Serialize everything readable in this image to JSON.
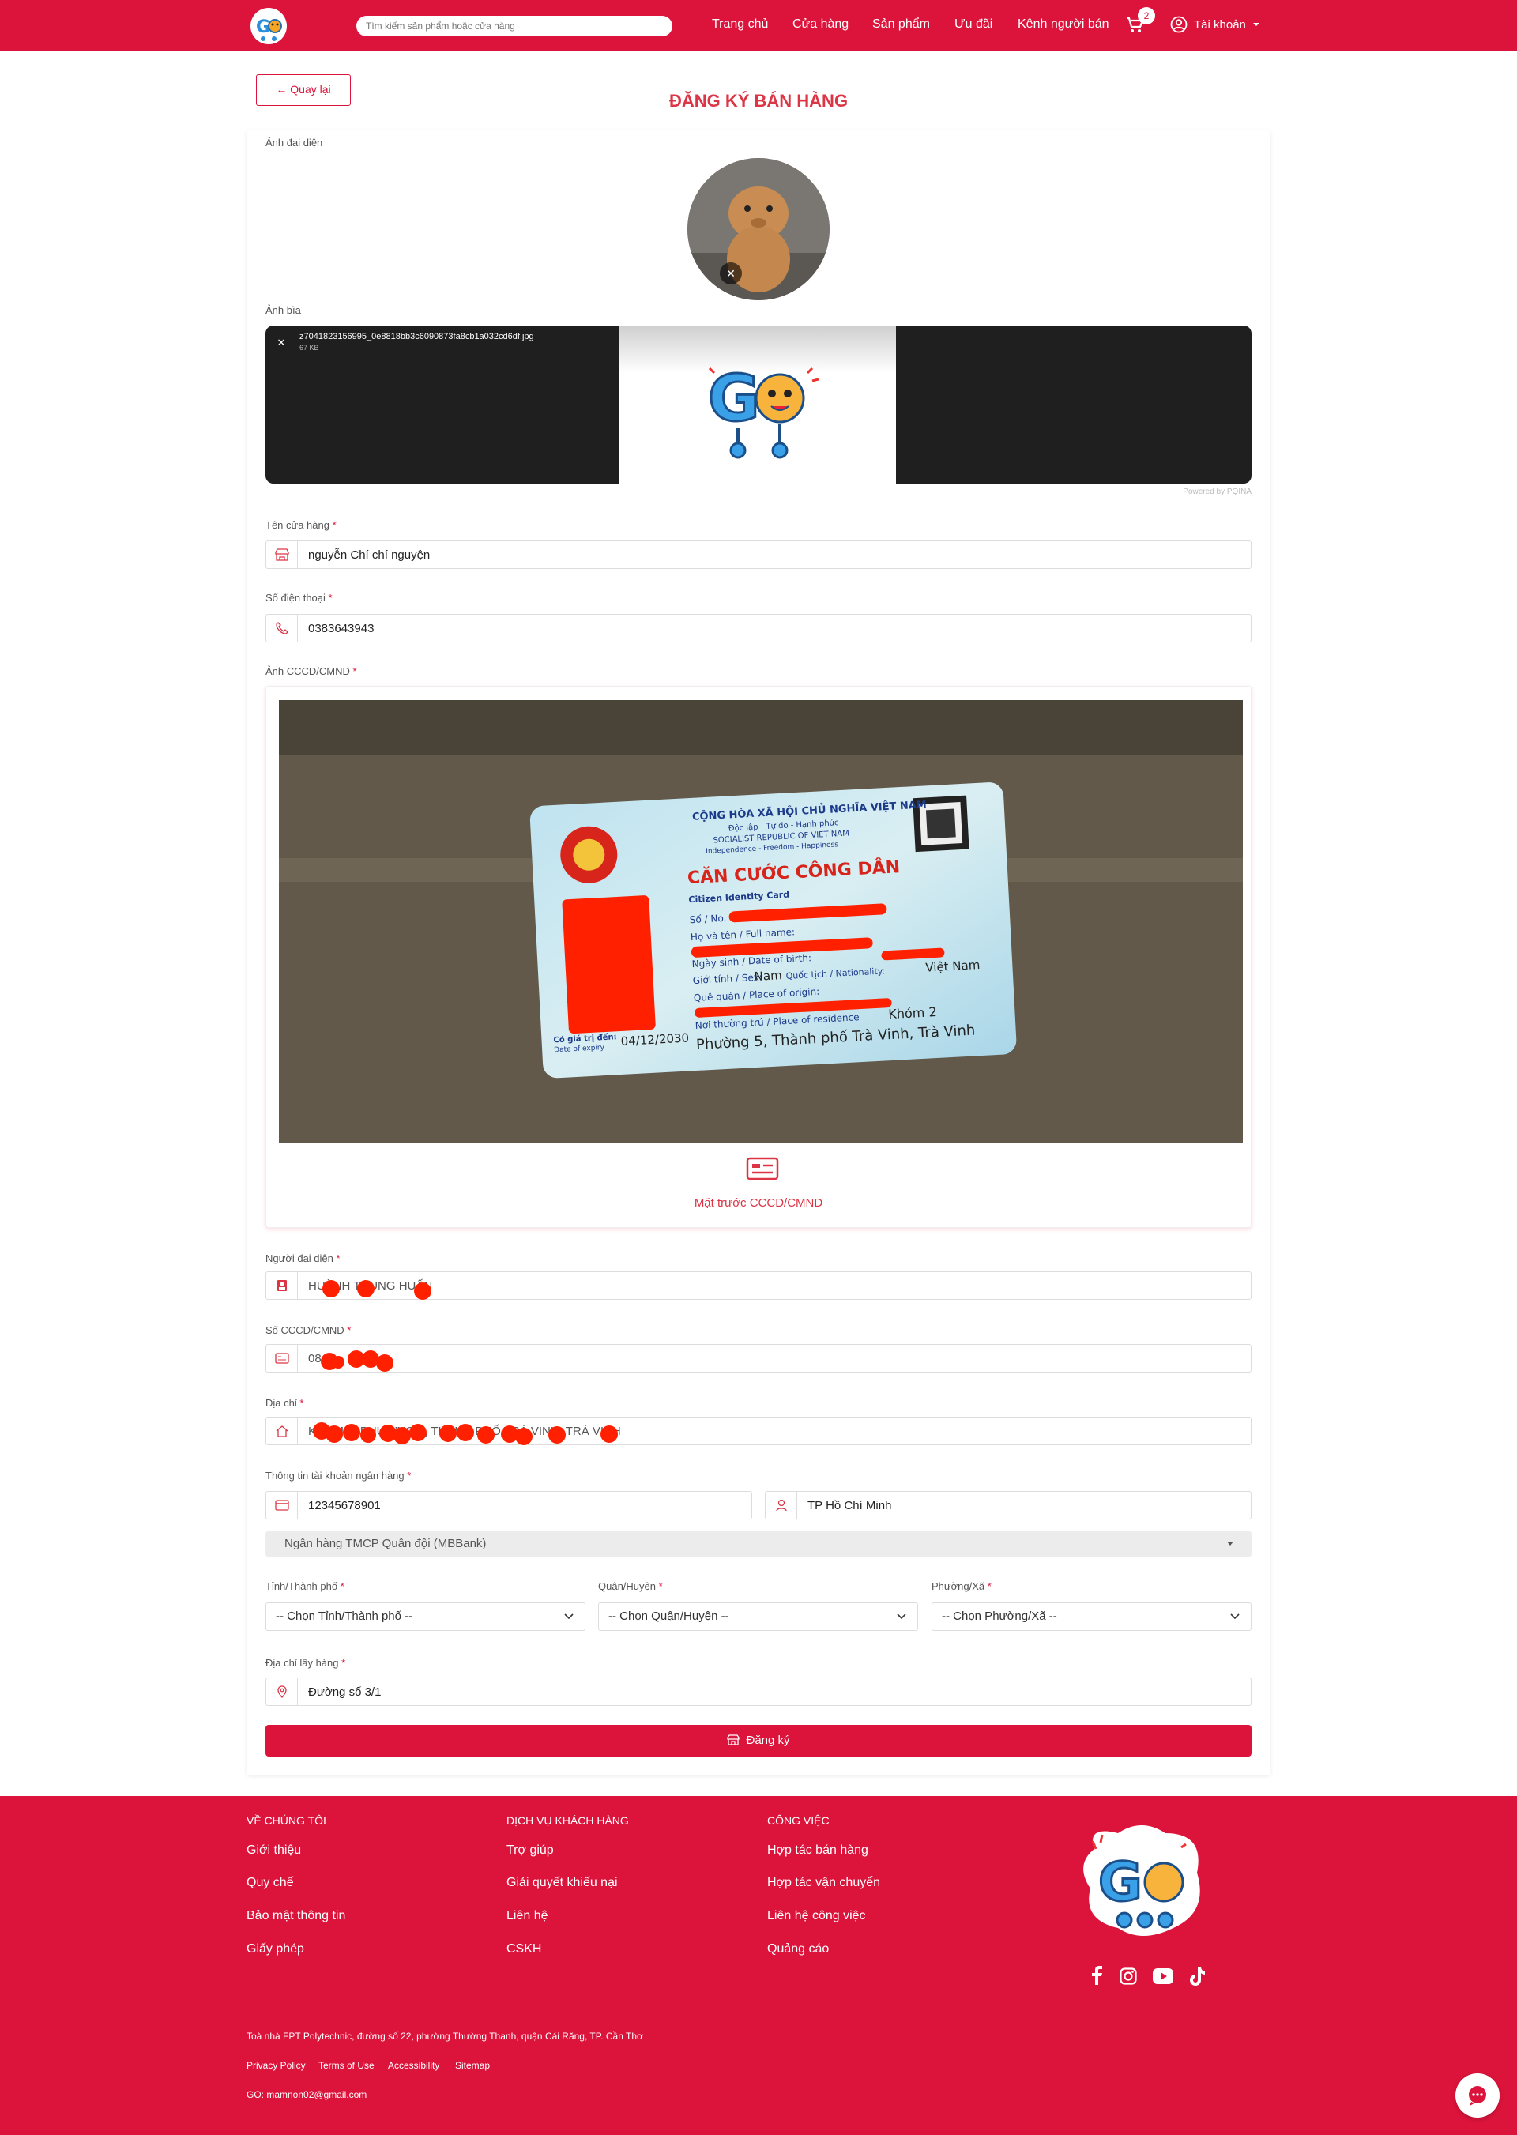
{
  "header": {
    "search_placeholder": "Tìm kiếm sản phẩm hoặc cửa hàng",
    "nav": [
      "Trang chủ",
      "Cửa hàng",
      "Sản phẩm",
      "Ưu đãi",
      "Kênh người bán"
    ],
    "cart_count": "2",
    "account_label": "Tài khoản"
  },
  "page": {
    "back_label": "← Quay lại",
    "title": "ĐĂNG KÝ BÁN HÀNG"
  },
  "form": {
    "avatar_label": "Ảnh đại diện",
    "cover_label": "Ảnh bìa",
    "cover_file_name": "z7041823156995_0e8818bb3c6090873fa8cb1a032cd6df.jpg",
    "cover_file_size": "67 KB",
    "powered_by": "Powered by PQINA",
    "store_name_label": "Tên cửa hàng",
    "store_name_value": "nguyễn Chí chí nguyện",
    "phone_label": "Số điện thoại",
    "phone_value": "0383643943",
    "id_image_label": "Ảnh CCCD/CMND",
    "id_image_caption": "Mặt trước CCCD/CMND",
    "representative_label": "Người đại diện",
    "representative_value": "HUỲNH TRUNG HUẤN",
    "id_number_label": "Số CCCD/CMND",
    "id_number_value": "084...",
    "address_label": "Địa chỉ",
    "address_value": "KHÓM 2, PHƯỜNG 5, THÀNH PHỐ TRÀ VINH, TRÀ VINH",
    "bank_info_label": "Thông tin tài khoản ngân hàng",
    "bank_account_value": "12345678901",
    "bank_holder_value": "TP Hồ Chí Minh",
    "bank_name_value": "Ngân hàng TMCP Quân đội (MBBank)",
    "province_label": "Tỉnh/Thành phố",
    "province_value": "-- Chọn Tỉnh/Thành phố --",
    "district_label": "Quận/Huyện",
    "district_value": "-- Chọn Quận/Huyện --",
    "ward_label": "Phường/Xã",
    "ward_value": "-- Chọn Phường/Xã --",
    "pickup_label": "Địa chỉ lấy hàng",
    "pickup_value": "Đường số 3/1",
    "submit_label": "Đăng ký",
    "required_mark": "*"
  },
  "id_card": {
    "country_line": "CỘNG HÒA XÃ HỘI CHỦ NGHĨA VIỆT NAM",
    "motto": "Độc lập - Tự do - Hạnh phúc",
    "country_en": "SOCIALIST REPUBLIC OF VIET NAM",
    "motto_en": "Independence - Freedom - Happiness",
    "title": "CĂN CƯỚC CÔNG DÂN",
    "title_en": "Citizen Identity Card",
    "no_label": "Số / No.",
    "name_label": "Họ và tên / Full name:",
    "dob_label": "Ngày sinh / Date of birth:",
    "sex_label": "Giới tính / Sex:",
    "sex_value": "Nam",
    "nationality_label": "Quốc tịch / Nationality:",
    "nationality_value": "Việt Nam",
    "origin_label": "Quê quán / Place of origin:",
    "residence_label": "Nơi thường trú / Place of residence",
    "residence_line1": "Khóm 2",
    "residence_line2": "Phường 5, Thành phố Trà Vinh, Trà Vinh",
    "expiry_label": "Có giá trị đến:",
    "expiry_label_en": "Date of expiry",
    "expiry_value": "04/12/2030"
  },
  "footer": {
    "col1_title": "VỀ CHÚNG TÔI",
    "col1_links": [
      "Giới thiệu",
      "Quy chế",
      "Bảo mật thông tin",
      "Giấy phép"
    ],
    "col2_title": "DỊCH VỤ KHÁCH HÀNG",
    "col2_links": [
      "Trợ giúp",
      "Giải quyết khiếu nại",
      "Liên hệ",
      "CSKH"
    ],
    "col3_title": "CÔNG VIỆC",
    "col3_links": [
      "Hợp tác bán hàng",
      "Hợp tác vận chuyển",
      "Liên hệ công việc",
      "Quảng cáo"
    ],
    "address": "Toà nhà FPT Polytechnic, đường số 22, phường Thường Thạnh, quận Cái Răng, TP. Cần Thơ",
    "policy_links": [
      "Privacy Policy",
      "Terms of Use",
      "Accessibility",
      "Sitemap"
    ],
    "email": "GO: mamnon02@gmail.com"
  },
  "colors": {
    "brand": "#dc143c",
    "title": "#dc3545"
  },
  "icons": [
    "logo-icon",
    "cart-icon",
    "user-circle-icon",
    "chevron-down-icon",
    "store-icon",
    "phone-icon",
    "id-card-icon",
    "home-icon",
    "credit-card-icon",
    "user-icon",
    "map-pin-icon",
    "facebook-icon",
    "instagram-icon",
    "youtube-icon",
    "tiktok-icon",
    "chat-icon"
  ]
}
